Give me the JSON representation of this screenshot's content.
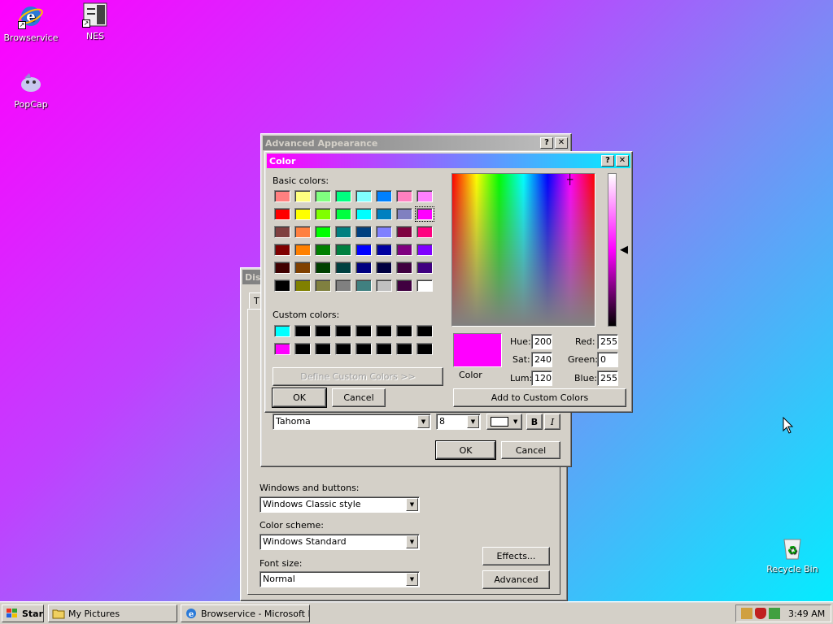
{
  "desktop": {
    "icons": [
      {
        "label": "Browservice",
        "icon": "ie-icon"
      },
      {
        "label": "NES",
        "icon": "nes-icon"
      },
      {
        "label": "PopCap",
        "icon": "popcap-icon"
      },
      {
        "label": "Recycle Bin",
        "icon": "recycle-bin-icon"
      }
    ]
  },
  "display_props": {
    "title_partial": "Disp",
    "tab_partial": "T",
    "windows_buttons_label": "Windows and buttons:",
    "windows_buttons_value": "Windows Classic style",
    "color_scheme_label": "Color scheme:",
    "color_scheme_value": "Windows Standard",
    "font_size_label": "Font size:",
    "font_size_value": "Normal",
    "effects_button": "Effects...",
    "advanced_button": "Advanced"
  },
  "advanced_appearance": {
    "title": "Advanced Appearance",
    "font_value": "Tahoma",
    "size_value": "8",
    "bold_label": "B",
    "italic_label": "I",
    "ok_button": "OK",
    "cancel_button": "Cancel"
  },
  "color_dialog": {
    "title": "Color",
    "help_label": "?",
    "close_label": "✕",
    "basic_colors_label": "Basic colors:",
    "custom_colors_label": "Custom colors:",
    "define_custom_button": "Define Custom Colors >>",
    "ok_button": "OK",
    "cancel_button": "Cancel",
    "color_solid_label": "Color",
    "hue_label": "Hue:",
    "sat_label": "Sat:",
    "lum_label": "Lum:",
    "hue_value": "200",
    "sat_value": "240",
    "lum_value": "120",
    "red_label": "Red:",
    "green_label": "Green:",
    "blue_label": "Blue:",
    "red_value": "255",
    "green_value": "0",
    "blue_value": "255",
    "add_custom_button": "Add to Custom Colors",
    "selected_color": "#ff00ff",
    "basic_colors": [
      [
        "#ff8080",
        "#ffff80",
        "#80ff80",
        "#00ff80",
        "#80ffff",
        "#0080ff",
        "#ff80c0",
        "#ff80ff"
      ],
      [
        "#ff0000",
        "#ffff00",
        "#80ff00",
        "#00ff40",
        "#00ffff",
        "#0080c0",
        "#8080c0",
        "#ff00ff"
      ],
      [
        "#804040",
        "#ff8040",
        "#00ff00",
        "#008080",
        "#004080",
        "#8080ff",
        "#800040",
        "#ff0080"
      ],
      [
        "#800000",
        "#ff8000",
        "#008000",
        "#008040",
        "#0000ff",
        "#0000a0",
        "#800080",
        "#8000ff"
      ],
      [
        "#400000",
        "#804000",
        "#004000",
        "#004040",
        "#000080",
        "#000040",
        "#400040",
        "#400080"
      ],
      [
        "#000000",
        "#808000",
        "#808040",
        "#808080",
        "#408080",
        "#c0c0c0",
        "#400040",
        "#ffffff"
      ]
    ],
    "custom_colors": [
      [
        "#00ffff",
        "#000000",
        "#000000",
        "#000000",
        "#000000",
        "#000000",
        "#000000",
        "#000000"
      ],
      [
        "#ff00ff",
        "#000000",
        "#000000",
        "#000000",
        "#000000",
        "#000000",
        "#000000",
        "#000000"
      ]
    ]
  },
  "taskbar": {
    "start_label": "Start",
    "tasks": [
      {
        "label": "My Pictures"
      },
      {
        "label": "Browservice - Microsoft I..."
      }
    ],
    "clock": "3:49 AM"
  }
}
